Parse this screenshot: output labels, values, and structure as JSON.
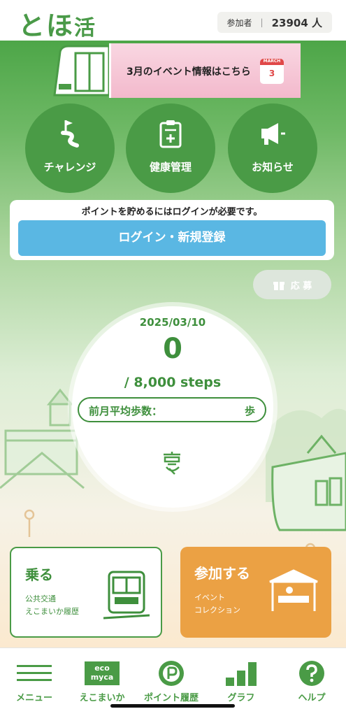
{
  "header": {
    "logo_main": "とほ",
    "logo_small": "活",
    "participants_label": "参加者",
    "participants_count": "23904 人"
  },
  "banner": {
    "text": "3月のイベント情報はこちら",
    "calendar_month": "MARCH",
    "calendar_day": "3"
  },
  "circle_buttons": [
    {
      "label": "チャレンジ",
      "icon": "flag-path-icon"
    },
    {
      "label": "健康管理",
      "icon": "clipboard-plus-icon"
    },
    {
      "label": "お知らせ",
      "icon": "megaphone-icon"
    }
  ],
  "login": {
    "message": "ポイントを貯めるにはログインが必要です。",
    "button": "ログイン・新規登録"
  },
  "apply": {
    "label": "応 募",
    "icon": "gift-icon"
  },
  "steps": {
    "date": "2025/03/10",
    "count": "0",
    "goal": "/ 8,000 steps",
    "avg_label": "前月平均歩数：",
    "avg_unit": "歩"
  },
  "cards": {
    "ride": {
      "title": "乗る",
      "line1": "公共交通",
      "line2": "えこまいか履歴",
      "icon": "tram-icon"
    },
    "join": {
      "title": "参加する",
      "line1": "イベント",
      "line2": "コレクション",
      "icon": "event-tent-icon"
    }
  },
  "nav": [
    {
      "label": "メニュー",
      "icon": "hamburger-icon"
    },
    {
      "label": "えこまいか",
      "icon": "ecomyca-icon",
      "badge_line1": "eco",
      "badge_line2": "myca"
    },
    {
      "label": "ポイント履歴",
      "icon": "point-p-icon"
    },
    {
      "label": "グラフ",
      "icon": "bar-graph-icon"
    },
    {
      "label": "ヘルプ",
      "icon": "help-question-icon"
    }
  ],
  "colors": {
    "brand_green": "#4a9b46",
    "login_blue": "#5ab7e3",
    "join_orange": "#eba144"
  }
}
